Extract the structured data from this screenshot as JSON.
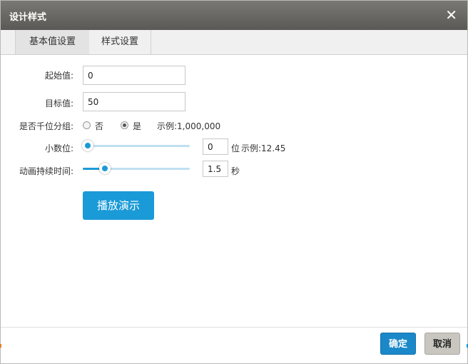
{
  "dialog": {
    "title": "设计样式"
  },
  "tabs": [
    {
      "label": "基本值设置",
      "active": true
    },
    {
      "label": "样式设置",
      "active": false
    }
  ],
  "fields": {
    "start": {
      "label": "起始值:",
      "value": "0"
    },
    "target": {
      "label": "目标值:",
      "value": "50"
    },
    "grouping": {
      "label": "是否千位分组:",
      "options": [
        {
          "label": "否",
          "checked": false
        },
        {
          "label": "是",
          "checked": true
        }
      ],
      "example": "示例:1,000,000"
    },
    "decimals": {
      "label": "小数位:",
      "value": "0",
      "unit": "位",
      "example": "示例:12.45",
      "slider_fraction": 0
    },
    "duration": {
      "label": "动画持续时间:",
      "value": "1.5",
      "unit": "秒",
      "slider_fraction": 0.16
    }
  },
  "play_button": "播放演示",
  "footer": {
    "ok": "确定",
    "cancel": "取消"
  },
  "colors": {
    "accent": "#1a9ad7",
    "titlebar": "#6b6965",
    "ok": "#1a88c9",
    "cancel": "#c9c6c0"
  },
  "icons": {
    "close": "close-icon"
  }
}
